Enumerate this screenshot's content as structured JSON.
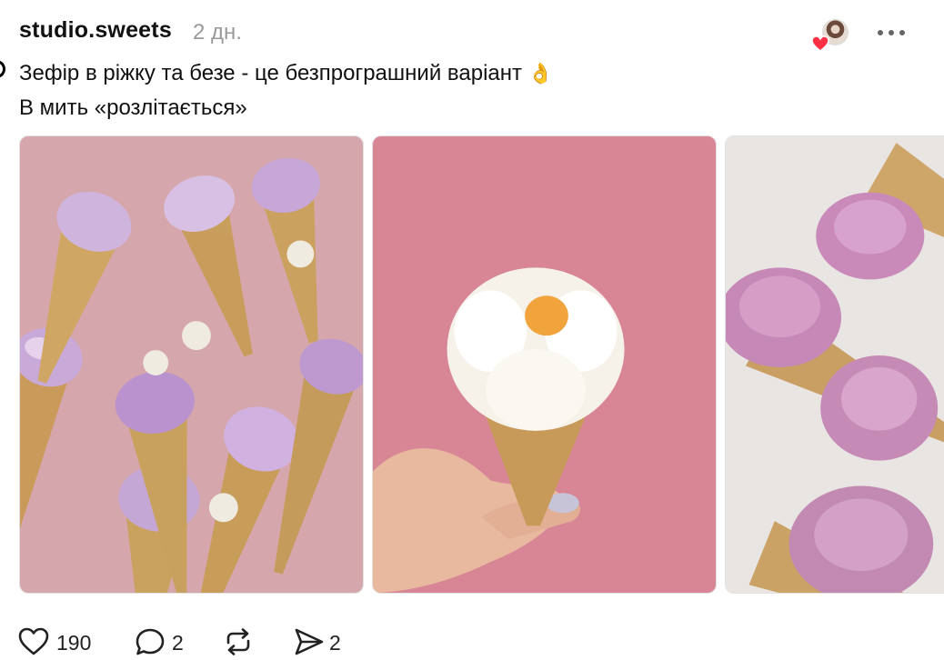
{
  "post": {
    "username": "studio.sweets",
    "time": "2 дн.",
    "caption": {
      "line1": "Зефір в ріжку та безе - це безпрограшний варіант",
      "emoji": "👌",
      "line2": "В мить «розлітається»"
    }
  },
  "actions": {
    "likes": "190",
    "comments": "2",
    "shares": "2"
  },
  "icons": {
    "heart": "heart-icon",
    "comment": "comment-icon",
    "repost": "repost-icon",
    "send": "send-icon",
    "more": "more-icon"
  },
  "colors": {
    "like_badge": "#ff3045",
    "secondary_text": "#9a9a9a",
    "pink_background": "#d88596"
  }
}
